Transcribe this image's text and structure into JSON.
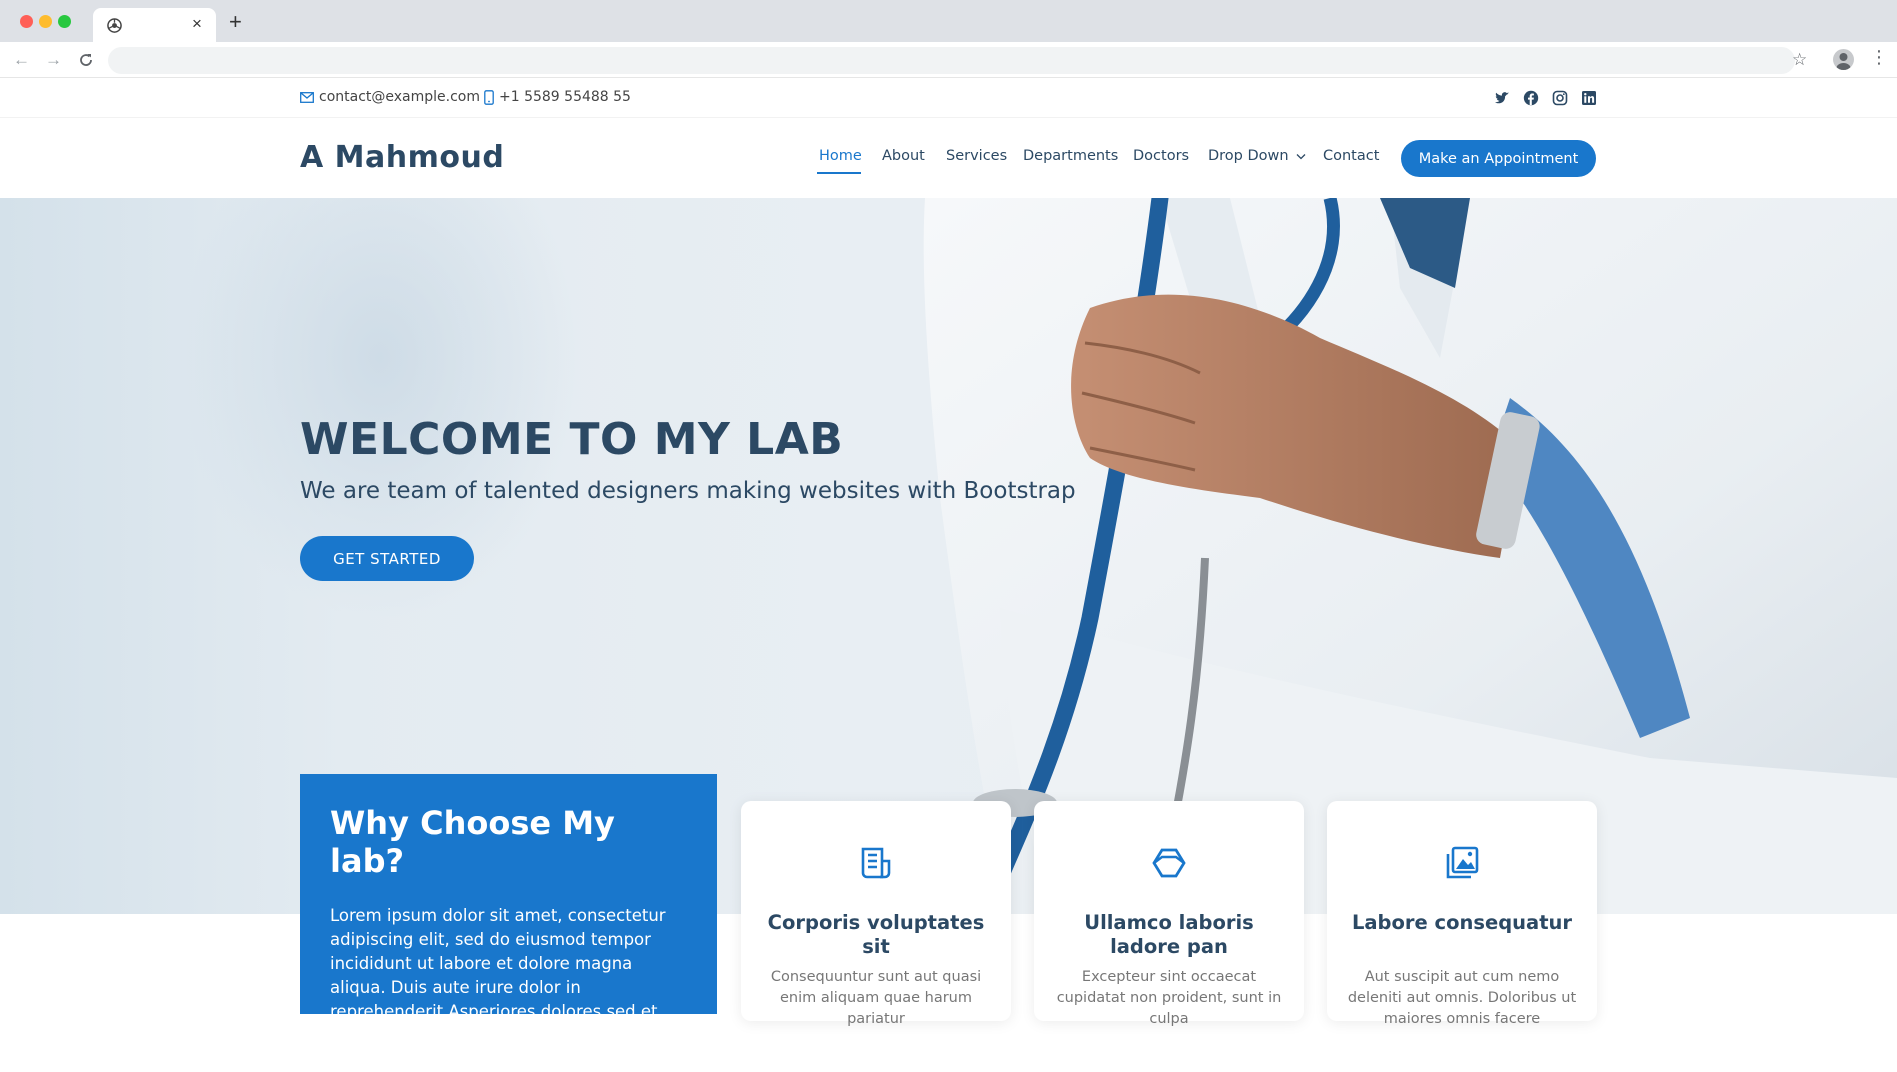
{
  "browser": {
    "new_tab_symbol": "+",
    "close_symbol": "×"
  },
  "topbar": {
    "email": "contact@example.com",
    "phone": "+1 5589 55488 55",
    "social_icons": [
      "twitter-icon",
      "facebook-icon",
      "instagram-icon",
      "linkedin-icon"
    ]
  },
  "header": {
    "logo": "A Mahmoud",
    "nav": [
      "Home",
      "About",
      "Services",
      "Departments",
      "Doctors",
      "Drop Down",
      "Contact"
    ],
    "active_nav": "Home",
    "cta": "Make an Appointment"
  },
  "hero": {
    "title": "WELCOME TO MY LAB",
    "subtitle": "We are team of talented designers making websites with Bootstrap",
    "button": "GET STARTED"
  },
  "why": {
    "title": "Why Choose My lab?",
    "text": "Lorem ipsum dolor sit amet, consectetur adipiscing elit, sed do eiusmod tempor incididunt ut labore et dolore magna aliqua. Duis aute irure dolor in reprehenderit Asperiores dolores sed et. Tenetur quia eos. Autem tempore quibusdam vel necessitatibus"
  },
  "cards": [
    {
      "icon": "receipt-icon",
      "title": "Corporis voluptates sit",
      "text": "Consequuntur sunt aut quasi enim aliquam quae harum pariatur"
    },
    {
      "icon": "cube-icon",
      "title": "Ullamco laboris ladore pan",
      "text": "Excepteur sint occaecat cupidatat non proident, sunt in culpa"
    },
    {
      "icon": "images-icon",
      "title": "Labore consequatur",
      "text": "Aut suscipit aut cum nemo deleniti aut omnis. Doloribus ut maiores omnis facere"
    }
  ],
  "colors": {
    "accent": "#1977cc",
    "heading": "#2c4964"
  }
}
